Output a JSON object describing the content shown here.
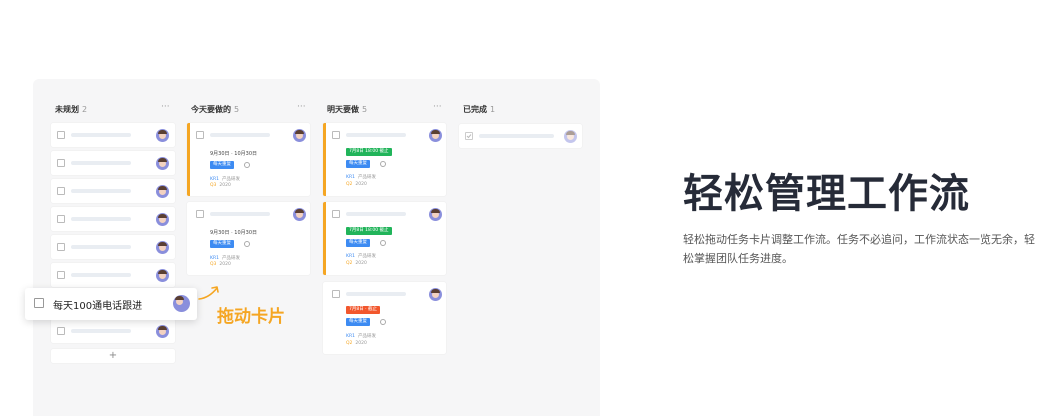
{
  "columns": [
    {
      "title": "未规划",
      "count": "2",
      "more": "···"
    },
    {
      "title": "今天要做的",
      "count": "5",
      "more": "···"
    },
    {
      "title": "明天要做",
      "count": "5",
      "more": "···"
    },
    {
      "title": "已完成",
      "count": "1"
    }
  ],
  "today_cards": [
    {
      "time": "9月30日 · 10月30日",
      "tag": "每天重复",
      "key": "KR1",
      "proj": "产品研发",
      "q": "Q3",
      "year": "2020"
    },
    {
      "time": "9月30日 · 10月30日",
      "tag": "每天重复",
      "key": "KR1",
      "proj": "产品研发",
      "q": "Q3",
      "year": "2020"
    }
  ],
  "tomorrow_cards": [
    {
      "date_tag": "7月8日 18:00 截止",
      "tag": "每天重复",
      "key": "KR1",
      "proj": "产品研发",
      "q": "Q2",
      "year": "2020"
    },
    {
      "date_tag": "7月8日 18:00 截止",
      "tag": "每天重复",
      "key": "KR1",
      "proj": "产品研发",
      "q": "Q2",
      "year": "2020"
    },
    {
      "date_tag": "7月8日 · 截止",
      "tag": "每天重复",
      "key": "KR1",
      "proj": "产品研发",
      "q": "Q2",
      "year": "2020"
    }
  ],
  "add_label": "+",
  "drag_card_text": "每天100通电话跟进",
  "drag_label": "拖动卡片",
  "hero": {
    "title": "轻松管理工作流",
    "desc": "轻松拖动任务卡片调整工作流。任务不必追问，工作流状态一览无余，轻松掌握团队任务进度。"
  },
  "colors": {
    "accent": "#f5a623",
    "green": "#21b45a",
    "red": "#f2572d",
    "blue": "#3d8bf2"
  }
}
